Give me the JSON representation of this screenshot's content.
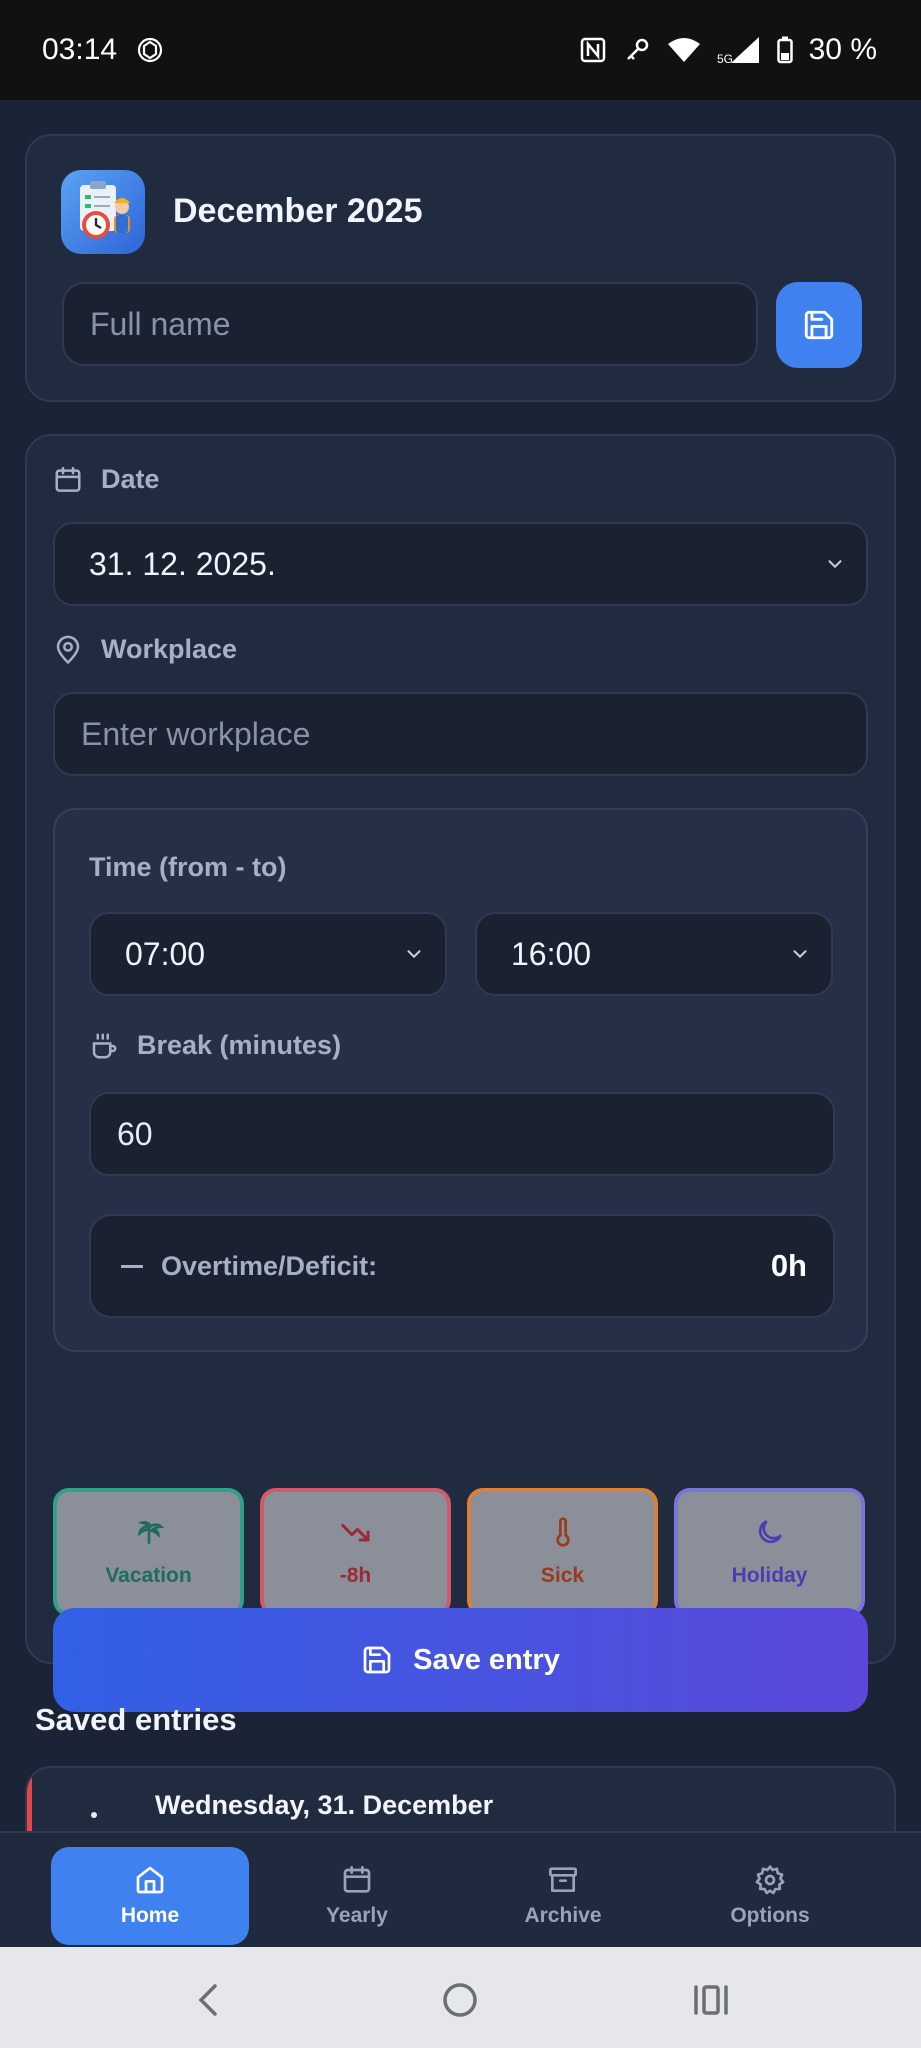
{
  "status_bar": {
    "time": "03:14",
    "battery_percent": "30 %",
    "network_label": "5G"
  },
  "header": {
    "title": "December 2025",
    "name_placeholder": "Full name",
    "save_icon": "save-icon"
  },
  "form": {
    "date_label": "Date",
    "date_value": "31. 12. 2025.",
    "workplace_label": "Workplace",
    "workplace_placeholder": "Enter workplace",
    "time_label": "Time (from - to)",
    "time_from": "07:00",
    "time_to": "16:00",
    "break_label": "Break (minutes)",
    "break_value": "60",
    "overtime_label": "Overtime/Deficit:",
    "overtime_value": "0h"
  },
  "entry_types": [
    {
      "label": "Vacation",
      "icon": "palm-tree-icon",
      "color": "#1f6b5f",
      "border": "#2fa08a"
    },
    {
      "label": "-8h",
      "icon": "trending-down-icon",
      "color": "#9b2a35",
      "border": "#d05a68"
    },
    {
      "label": "Sick",
      "icon": "thermometer-icon",
      "color": "#9a3a1f",
      "border": "#d9803a"
    },
    {
      "label": "Holiday",
      "icon": "moon-icon",
      "color": "#4b3db3",
      "border": "#7a76d6"
    }
  ],
  "save_entry_label": "Save entry",
  "saved_section": {
    "title": "Saved entries",
    "entries": [
      {
        "date": "Wednesday, 31. December",
        "accent": "#e04848"
      }
    ]
  },
  "bottom_nav": [
    {
      "label": "Home",
      "icon": "home-icon",
      "active": true
    },
    {
      "label": "Yearly",
      "icon": "calendar-icon",
      "active": false
    },
    {
      "label": "Archive",
      "icon": "archive-icon",
      "active": false
    },
    {
      "label": "Options",
      "icon": "gear-icon",
      "active": false
    }
  ],
  "colors": {
    "background": "#1b2336",
    "card": "#212b40",
    "accent_blue": "#3f82ef",
    "gradient_start": "#3260e6",
    "gradient_end": "#5b48db"
  }
}
